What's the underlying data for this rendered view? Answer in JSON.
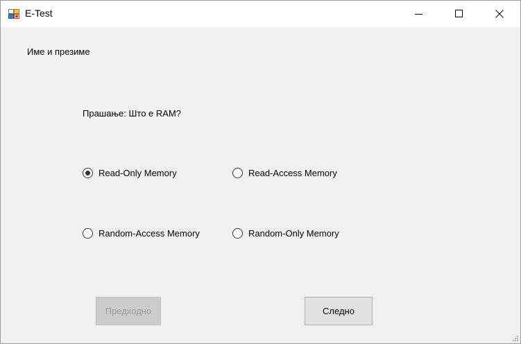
{
  "window": {
    "title": "E-Test",
    "app_icon": "form-app-icon",
    "controls": [
      "minimize-icon",
      "maximize-icon",
      "close-icon"
    ]
  },
  "form": {
    "name_label": "Име и презиме",
    "question": "Прашање: Што е RAM?",
    "options": [
      {
        "label": "Read-Only Memory",
        "selected": true
      },
      {
        "label": "Read-Access Memory",
        "selected": false
      },
      {
        "label": "Random-Access Memory",
        "selected": false
      },
      {
        "label": "Random-Only Memory",
        "selected": false
      }
    ],
    "buttons": {
      "previous_label": "Предходно",
      "previous_enabled": false,
      "next_label": "Следно",
      "next_enabled": true
    }
  }
}
